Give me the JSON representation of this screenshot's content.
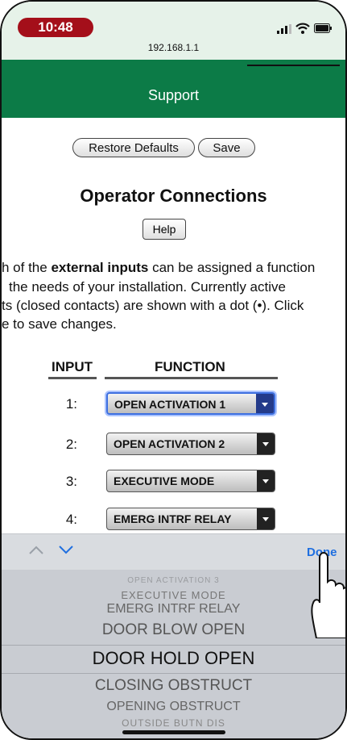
{
  "status_bar": {
    "time": "10:48",
    "url": "192.168.1.1",
    "accent_color": "#a40f1a",
    "icons": [
      "signal-icon",
      "wifi-icon",
      "battery-icon"
    ]
  },
  "header": {
    "title": "Support",
    "bg_color": "#0c7b47"
  },
  "actions": {
    "restore_label": "Restore Defaults",
    "save_label": "Save"
  },
  "page_title": "Operator Connections",
  "help_label": "Help",
  "description": {
    "line1_pre": "h of the ",
    "line1_bold": "external inputs",
    "line1_post": " can be assigned a function",
    "line2": "the needs of your installation. Currently active",
    "line3": "ts (closed contacts) are shown with a dot (•). Click",
    "line4": "e to save changes."
  },
  "table": {
    "col_input": "INPUT",
    "col_function": "FUNCTION",
    "rows": [
      {
        "num": "1:",
        "value": "OPEN ACTIVATION 1"
      },
      {
        "num": "2:",
        "value": "OPEN ACTIVATION 2"
      },
      {
        "num": "3:",
        "value": "EXECUTIVE MODE"
      },
      {
        "num": "4:",
        "value": "EMERG INTRF RELAY"
      }
    ]
  },
  "toolbar": {
    "prev_icon": "chevron-up-icon",
    "next_icon": "chevron-down-icon",
    "done_label": "Done"
  },
  "picker": {
    "items": [
      "OPEN ACTIVATION 3",
      "EXECUTIVE MODE",
      "EMERG INTRF RELAY",
      "DOOR BLOW OPEN",
      "DOOR HOLD OPEN",
      "CLOSING OBSTRUCT",
      "OPENING OBSTRUCT",
      "OUTSIDE BUTN DIS"
    ],
    "selected": "DOOR HOLD OPEN"
  }
}
